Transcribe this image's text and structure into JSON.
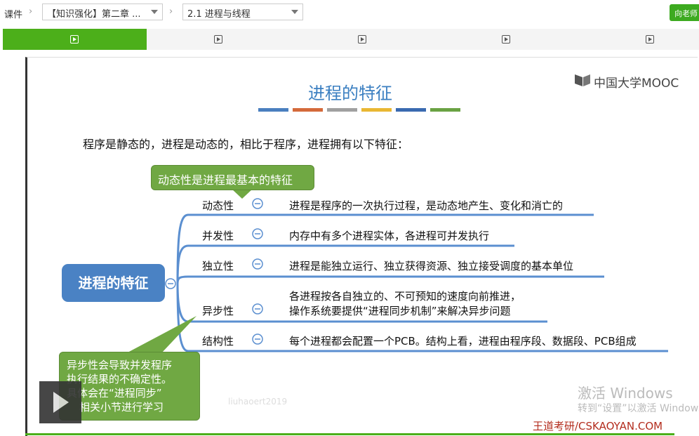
{
  "breadcrumb": {
    "root": "课件",
    "chapter": "【知识强化】第二章 ...",
    "section": "2.1 进程与线程"
  },
  "ask_teacher": "向老师",
  "tabs": [
    {
      "icon": "play-icon",
      "active": true
    },
    {
      "icon": "play-icon",
      "active": false
    },
    {
      "icon": "play-icon",
      "active": false
    },
    {
      "icon": "play-icon",
      "active": false
    },
    {
      "icon": "play-icon",
      "active": false
    }
  ],
  "slide": {
    "title": "进程的特征",
    "title_bar_colors": [
      "#4a7fbf",
      "#d46a3b",
      "#a0a0a0",
      "#e9b733",
      "#3a6ab0",
      "#6aa243"
    ],
    "logo": "中国大学MOOC",
    "intro": "程序是静态的，进程是动态的，相比于程序，进程拥有以下特征：",
    "callout_top": "动态性是进程最基本的特征",
    "callout_bottom": [
      "异步性会导致并发程序",
      "执行结果的不确定性。",
      "具体会在“进程同步”",
      "相关小节进行学习"
    ],
    "central_node": "进程的特征",
    "branches": [
      {
        "label": "动态性",
        "desc": [
          "进程是程序的一次执行过程，是动态地产生、变化和消亡的"
        ]
      },
      {
        "label": "并发性",
        "desc": [
          "内存中有多个进程实体，各进程可并发执行"
        ]
      },
      {
        "label": "独立性",
        "desc": [
          "进程是能独立运行、独立获得资源、独立接受调度的基本单位"
        ]
      },
      {
        "label": "异步性",
        "desc": [
          "各进程按各自独立的、不可预知的速度向前推进，",
          "操作系统要提供“进程同步机制”来解决异步问题"
        ]
      },
      {
        "label": "结构性",
        "desc": [
          "每个进程都会配置一个PCB。结构上看，进程由程序段、数据段、PCB组成"
        ]
      }
    ],
    "watermark": "liuhaoert2019",
    "brand": "王道考研/CSKAOYAN.COM"
  },
  "os_overlay": {
    "activate_title": "激活 Windows",
    "activate_sub": "转到“设置”以激活 Windows。"
  },
  "colors": {
    "accent_green": "#4caf1a",
    "node_blue": "#4a82c4",
    "line_blue": "#5b8fd0",
    "callout_green": "#70a843"
  }
}
